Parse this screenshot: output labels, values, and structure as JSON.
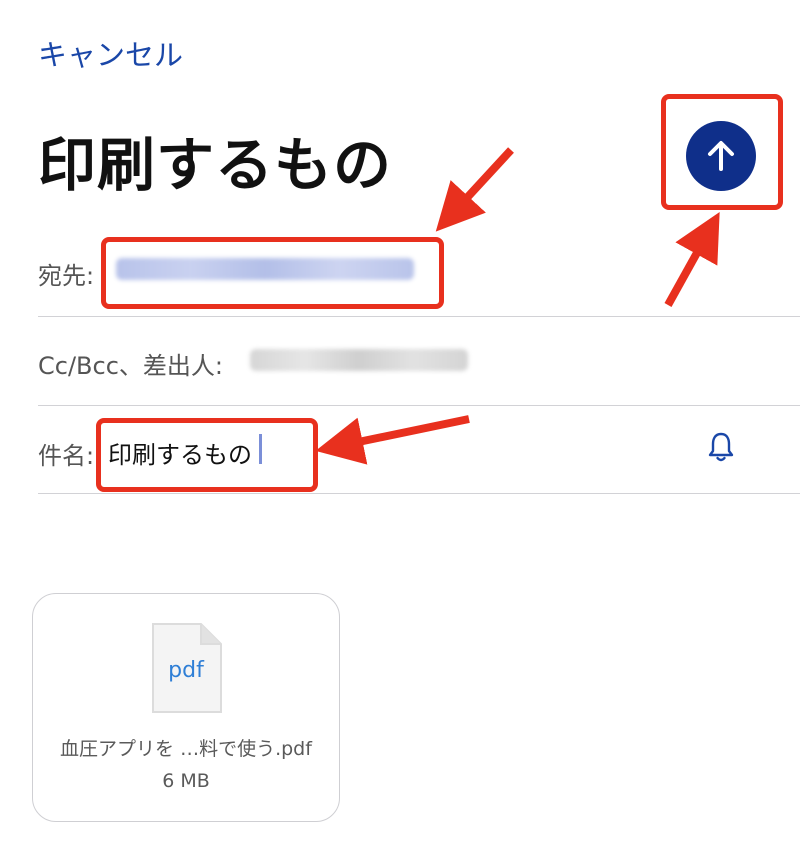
{
  "header": {
    "cancel_label": "キャンセル",
    "title": "印刷するもの",
    "send_icon": "arrow-up-icon"
  },
  "fields": {
    "to": {
      "label": "宛先:",
      "value_state": "blurred"
    },
    "cc_bcc": {
      "label": "Cc/Bcc、差出人:",
      "value_state": "blurred"
    },
    "subject": {
      "label": "件名:",
      "value": "印刷するもの",
      "icon": "bell-icon"
    }
  },
  "attachment": {
    "type_label": "pdf",
    "file_name": "血圧アプリを …料で使う.pdf",
    "file_size": "6 MB"
  },
  "colors": {
    "accent": "#1a47a8",
    "send_button": "#0f2f8a",
    "annotation": "#e8301e"
  }
}
